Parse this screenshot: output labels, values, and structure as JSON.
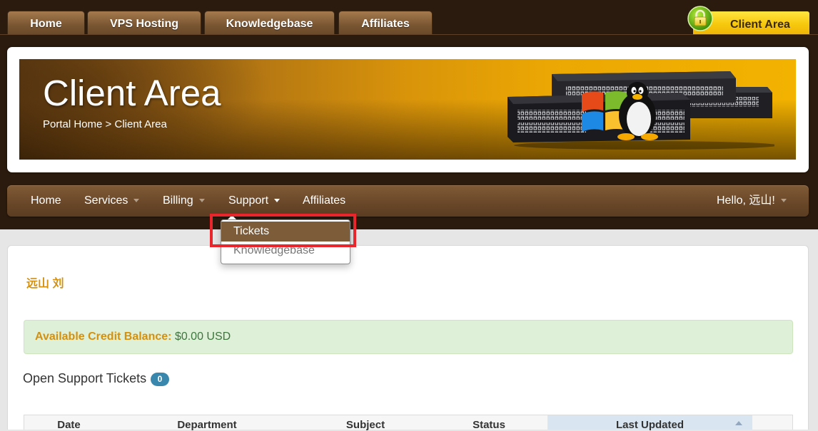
{
  "top_tabs": [
    {
      "label": "Home"
    },
    {
      "label": "VPS Hosting"
    },
    {
      "label": "Knowledgebase"
    },
    {
      "label": "Affiliates"
    }
  ],
  "client_area_tab": {
    "label": "Client Area",
    "icon": "lock-icon"
  },
  "header": {
    "title": "Client Area",
    "breadcrumb": {
      "home": "Portal Home",
      "separator": ">",
      "current": "Client Area"
    }
  },
  "nav": {
    "items": [
      {
        "label": "Home"
      },
      {
        "label": "Services"
      },
      {
        "label": "Billing"
      },
      {
        "label": "Support",
        "active": true
      },
      {
        "label": "Affiliates"
      }
    ],
    "user_menu": {
      "label": "Hello, 远山!"
    }
  },
  "support_dropdown": {
    "items": [
      {
        "label": "Tickets",
        "highlighted": true
      },
      {
        "label": "Knowledgebase"
      }
    ]
  },
  "main": {
    "user_name": "远山 刘",
    "credit": {
      "label": "Available Credit Balance:",
      "value": "$0.00 USD"
    },
    "tickets": {
      "title": "Open Support Tickets",
      "count": "0",
      "columns": [
        {
          "label": "Date"
        },
        {
          "label": "Department"
        },
        {
          "label": "Subject"
        },
        {
          "label": "Status"
        },
        {
          "label": "Last Updated",
          "sorted": true,
          "sort_icon": "sort-up-icon"
        }
      ]
    }
  },
  "icons": {
    "client_area": "lock-icon",
    "menu_caret": "caret-down-icon",
    "sort": "sort-up-icon"
  },
  "colors": {
    "top_background": "#2b1b0e",
    "tab": "#7a5632",
    "client_area_tab": "#f7c90e",
    "nav_bar": "#6a4829",
    "dropdown_active": "#7d5c3a",
    "accent_orange": "#d4900f",
    "success_bg": "#dff0d8",
    "success_text": "#3c763d",
    "badge": "#3a87ad",
    "sorted_column_bg": "#d9e6f2",
    "annotation_box": "#e8262b"
  }
}
